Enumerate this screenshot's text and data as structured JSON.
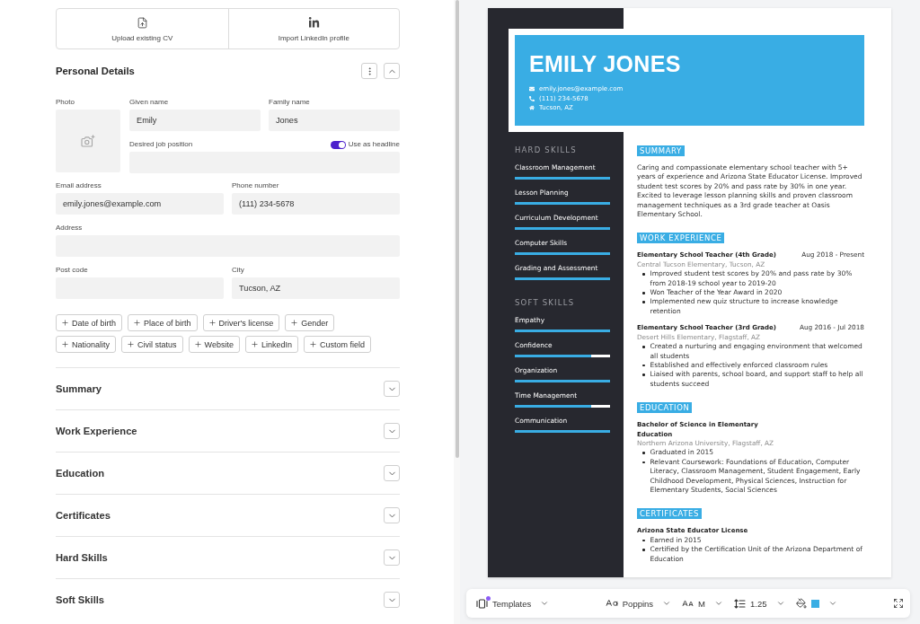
{
  "import_options": [
    {
      "kind": "upload",
      "label": "Upload existing CV"
    },
    {
      "kind": "linkedin",
      "label": "Import LinkedIn profile"
    }
  ],
  "personal_details": {
    "title": "Personal Details",
    "expanded": true,
    "photo_label": "Photo",
    "given_name": {
      "label": "Given name",
      "value": "Emily"
    },
    "family_name": {
      "label": "Family name",
      "value": "Jones"
    },
    "job_position": {
      "label": "Desired job position"
    },
    "headline_toggle": {
      "label": "Use as headline",
      "on": true
    },
    "email": {
      "label": "Email address",
      "value": "emily.jones@example.com"
    },
    "phone": {
      "label": "Phone number",
      "value": "(111) 234-5678"
    },
    "address": {
      "label": "Address"
    },
    "post_code": {
      "label": "Post code"
    },
    "city": {
      "label": "City",
      "value": "Tucson, AZ"
    },
    "add_fields": [
      "Date of birth",
      "Place of birth",
      "Driver's license",
      "Gender",
      "Nationality",
      "Civil status",
      "Website",
      "LinkedIn",
      "Custom field"
    ]
  },
  "sections": [
    {
      "title": "Summary",
      "expanded": false
    },
    {
      "title": "Work Experience",
      "expanded": false
    },
    {
      "title": "Education",
      "expanded": false
    },
    {
      "title": "Certificates",
      "expanded": false
    },
    {
      "title": "Hard Skills",
      "expanded": false
    },
    {
      "title": "Soft Skills",
      "expanded": false
    }
  ],
  "resume": {
    "name": "EMILY JONES",
    "contacts": [
      {
        "kind": "email",
        "text": "emily.jones@example.com"
      },
      {
        "kind": "phone",
        "text": "(111) 234-5678"
      },
      {
        "kind": "location",
        "text": "Tucson, AZ"
      }
    ],
    "sidebar": [
      {
        "title": "HARD SKILLS",
        "skills": [
          {
            "name": "Classroom Management",
            "level": 1
          },
          {
            "name": "Lesson Planning",
            "level": 1
          },
          {
            "name": "Curriculum Development",
            "level": 1
          },
          {
            "name": "Computer Skills",
            "level": 1
          },
          {
            "name": "Grading and Assessment",
            "level": 1
          }
        ]
      },
      {
        "title": "SOFT SKILLS",
        "skills": [
          {
            "name": "Empathy",
            "level": 1
          },
          {
            "name": "Confidence",
            "level": 0.8
          },
          {
            "name": "Organization",
            "level": 1
          },
          {
            "name": "Time Management",
            "level": 0.8
          },
          {
            "name": "Communication",
            "level": 1
          }
        ]
      }
    ],
    "sections": [
      {
        "kind": "text",
        "title": "SUMMARY",
        "text": "Caring and compassionate elementary school teacher with 5+ years of experience and Arizona State Educator License. Improved student test scores by 20% and pass rate by 30% in one year. Excited to leverage lesson planning skills and proven classroom management techniques as a 3rd grade teacher at Oasis Elementary School."
      },
      {
        "kind": "entries",
        "title": "WORK EXPERIENCE",
        "entries": [
          {
            "title": "Elementary School Teacher (4th Grade)",
            "date": "Aug 2018 - Present",
            "place": "Central Tucson Elementary, Tucson, AZ",
            "bullets": [
              "Improved student test scores by 20% and pass rate by 30% from 2018-19 school year to 2019-20",
              "Won Teacher of the Year Award in 2020",
              "Implemented new quiz structure to increase knowledge retention"
            ]
          },
          {
            "title": "Elementary School Teacher (3rd Grade)",
            "date": "Aug 2016 - Jul 2018",
            "place": "Desert Hills Elementary, Flagstaff, AZ",
            "bullets": [
              "Created a nurturing and engaging environment that welcomed all students",
              "Established and effectively enforced classroom rules",
              "Liaised with parents, school board, and support staff to help all students succeed"
            ]
          }
        ]
      },
      {
        "kind": "entries",
        "title": "EDUCATION",
        "entries": [
          {
            "title": "Bachelor of Science in Elementary Education",
            "place": "Northern Arizona University, Flagstaff, AZ",
            "bullets": [
              "Graduated in 2015",
              "Relevant Coursework: Foundations of Education, Computer Literacy, Classroom Management, Student Engagement, Early Childhood Development, Physical Sciences, Instruction for Elementary Students, Social Sciences"
            ]
          }
        ]
      },
      {
        "kind": "entries",
        "title": "CERTIFICATES",
        "entries": [
          {
            "title": "Arizona State Educator License",
            "bullets": [
              "Earned in 2015",
              "Certified by the Certification Unit of the Arizona Department of Education"
            ]
          }
        ]
      }
    ]
  },
  "toolbar": {
    "templates": {
      "label": "Templates",
      "has_notification": true
    },
    "font": {
      "value": "Poppins"
    },
    "text_size": {
      "value": "M"
    },
    "line_height": {
      "value": "1.25"
    },
    "color_picker": {
      "color": "#3aaee4"
    }
  }
}
